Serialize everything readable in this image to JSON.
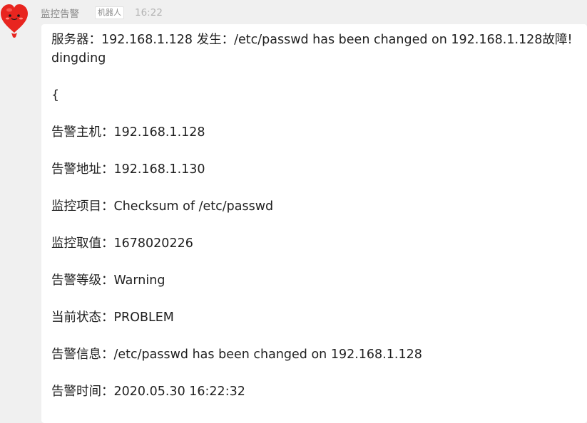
{
  "message": {
    "sender": "监控告警",
    "tag": "机器人",
    "time": "16:22",
    "avatar_icon": "red-heart-mascot-icon",
    "headline_1": "服务器：192.168.1.128 发生：/etc/passwd has been changed on 192.168.1.128故障!",
    "headline_2": "dingding",
    "brace": "{",
    "lines": [
      "告警主机：192.168.1.128",
      "告警地址：192.168.1.130",
      "监控项目：Checksum of /etc/passwd",
      "监控取值：1678020226",
      "告警等级：Warning",
      "当前状态：PROBLEM",
      "告警信息：/etc/passwd has been changed on 192.168.1.128",
      "告警时间：2020.05.30 16:22:32"
    ]
  },
  "colors": {
    "background": "#f0f0f0",
    "bubble": "#ffffff",
    "text": "#1f1f1f",
    "sender": "#888888",
    "time": "#b3b3b3",
    "avatar_red": "#e8251f"
  }
}
